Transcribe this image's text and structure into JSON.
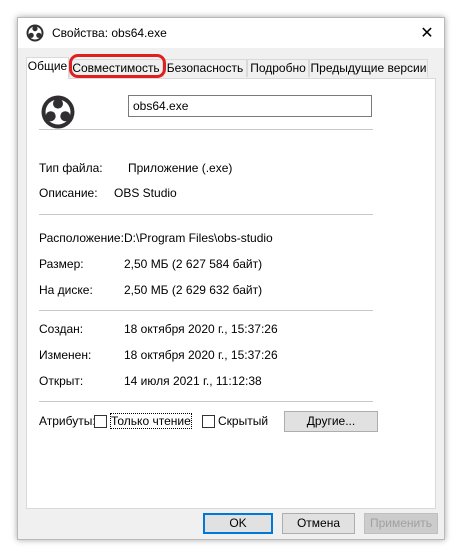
{
  "window": {
    "title": "Свойства: obs64.exe",
    "close_glyph": "✕"
  },
  "tabs": [
    {
      "label": "Общие",
      "active": true
    },
    {
      "label": "Совместимость",
      "active": false
    },
    {
      "label": "Безопасность",
      "active": false
    },
    {
      "label": "Подробно",
      "active": false
    },
    {
      "label": "Предыдущие версии",
      "active": false
    }
  ],
  "general": {
    "file_name": "obs64.exe",
    "file_type_label": "Тип файла:",
    "file_type_value": "Приложение (.exe)",
    "description_label": "Описание:",
    "description_value": "OBS Studio",
    "location_label": "Расположение:",
    "location_value": "D:\\Program Files\\obs-studio",
    "size_label": "Размер:",
    "size_value": "2,50 МБ (2 627 584 байт)",
    "disk_label": "На диске:",
    "disk_value": "2,50 МБ (2 629 632 байт)",
    "created_label": "Создан:",
    "created_value": "18 октября 2020 г., 15:37:26",
    "modified_label": "Изменен:",
    "modified_value": "18 октября 2020 г., 15:37:26",
    "accessed_label": "Открыт:",
    "accessed_value": "14 июля 2021 г., 11:12:38",
    "attributes_label": "Атрибуты:",
    "readonly_label": "Только чтение",
    "hidden_label": "Скрытый",
    "other_button": "Другие..."
  },
  "footer": {
    "ok": "OK",
    "cancel": "Отмена",
    "apply": "Применить"
  },
  "colors": {
    "highlight": "#e02020",
    "focus_blue": "#0078d7"
  }
}
